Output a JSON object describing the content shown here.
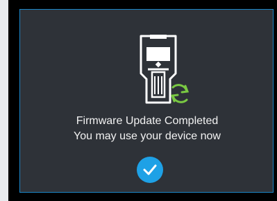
{
  "status": {
    "line1": "Firmware Update Completed",
    "line2": "You may use your device now"
  },
  "icons": {
    "device": "wall-scanner-device-icon",
    "sync": "sync-arrows-icon",
    "confirm": "checkmark-icon"
  },
  "colors": {
    "screen_background": "#2e3238",
    "screen_border": "#1c87c9",
    "text": "#f2f2f2",
    "sync_green": "#7ac943",
    "confirm_blue": "#1ea1e6"
  }
}
